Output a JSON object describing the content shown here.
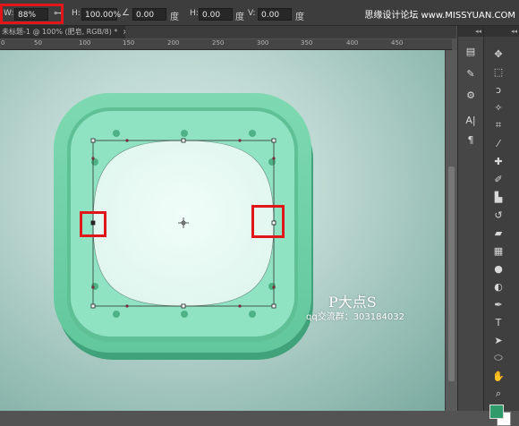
{
  "options_bar": {
    "w_label": "W:",
    "w_value": "88%",
    "h_label": "H:",
    "h_value": "100.00%",
    "angle_value": "0.00",
    "angle_unit": "度",
    "hskew_label": "H:",
    "hskew_value": "0.00",
    "hskew_unit": "度",
    "vskew_label": "V:",
    "vskew_value": "0.00",
    "vskew_unit": "度"
  },
  "watermark": "思缘设计论坛 www.MISSYUAN.COM",
  "document_tab": "未标题-1 @ 100% (肥皂, RGB/8) *",
  "ruler": [
    "0",
    "50",
    "100",
    "150",
    "200",
    "250",
    "300",
    "350",
    "400",
    "450"
  ],
  "canvas": {
    "author": "P大点S",
    "group_note": "qq交流群：303184032"
  },
  "panel_bar_label": "◂◂",
  "colors": {
    "highlight": "#e0161b",
    "icon_outer": "#6dcfa5",
    "icon_inner": "#8fe2c2",
    "soap": "#e7faf4"
  }
}
